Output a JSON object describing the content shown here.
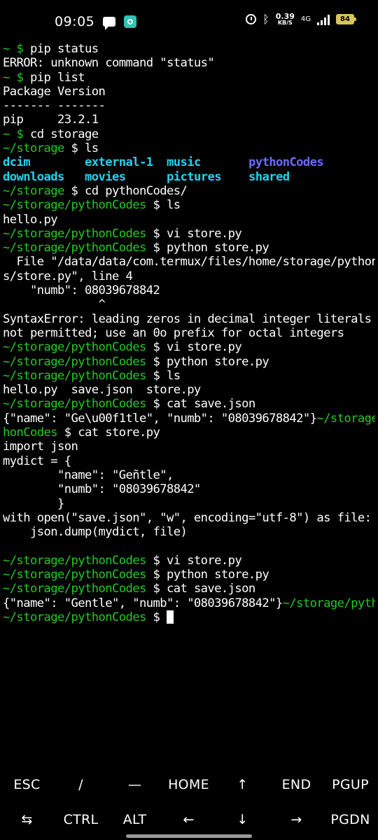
{
  "status_bar": {
    "time": "09:05",
    "net_speed": "0.39",
    "net_speed_unit": "KB/S",
    "network_type": "4G",
    "battery": "84",
    "icons": [
      "message-icon",
      "app-notification-icon",
      "alarm-icon",
      "bluetooth-icon",
      "signal-icon",
      "battery-icon"
    ]
  },
  "terminal": {
    "lines": [
      [
        {
          "t": "~ $ ",
          "c": "green"
        },
        {
          "t": "pip status",
          "c": "white"
        }
      ],
      [
        {
          "t": "ERROR: unknown command \"status\"",
          "c": "white"
        }
      ],
      [
        {
          "t": "~ $ ",
          "c": "green"
        },
        {
          "t": "pip list",
          "c": "white"
        }
      ],
      [
        {
          "t": "Package Version",
          "c": "white"
        }
      ],
      [
        {
          "t": "------- -------",
          "c": "white"
        }
      ],
      [
        {
          "t": "pip     23.2.1",
          "c": "white"
        }
      ],
      [
        {
          "t": "~ $ ",
          "c": "green"
        },
        {
          "t": "cd storage",
          "c": "white"
        }
      ],
      [
        {
          "t": "~/storage ",
          "c": "green"
        },
        {
          "t": "$ ls",
          "c": "white"
        }
      ],
      [
        {
          "t": "dcim        ",
          "c": "cyan"
        },
        {
          "t": "external-1  ",
          "c": "cyan"
        },
        {
          "t": "music       ",
          "c": "cyan"
        },
        {
          "t": "pythonCodes",
          "c": "blue"
        }
      ],
      [
        {
          "t": "downloads   ",
          "c": "cyan"
        },
        {
          "t": "movies      ",
          "c": "cyan"
        },
        {
          "t": "pictures    ",
          "c": "cyan"
        },
        {
          "t": "shared",
          "c": "cyan"
        }
      ],
      [
        {
          "t": "~/storage ",
          "c": "green"
        },
        {
          "t": "$ cd pythonCodes/",
          "c": "white"
        }
      ],
      [
        {
          "t": "~/storage/pythonCodes ",
          "c": "green"
        },
        {
          "t": "$ ls",
          "c": "white"
        }
      ],
      [
        {
          "t": "hello.py",
          "c": "white"
        }
      ],
      [
        {
          "t": "~/storage/pythonCodes ",
          "c": "green"
        },
        {
          "t": "$ vi store.py",
          "c": "white"
        }
      ],
      [
        {
          "t": "~/storage/pythonCodes ",
          "c": "green"
        },
        {
          "t": "$ python store.py",
          "c": "white"
        }
      ],
      [
        {
          "t": "  File \"/data/data/com.termux/files/home/storage/pythonCode",
          "c": "white"
        }
      ],
      [
        {
          "t": "s/store.py\", line 4",
          "c": "white"
        }
      ],
      [
        {
          "t": "    \"numb\": 08039678842",
          "c": "white"
        }
      ],
      [
        {
          "t": "              ^",
          "c": "white"
        }
      ],
      [
        {
          "t": "SyntaxError: leading zeros in decimal integer literals are",
          "c": "white"
        }
      ],
      [
        {
          "t": "not permitted; use an 0o prefix for octal integers",
          "c": "white"
        }
      ],
      [
        {
          "t": "~/storage/pythonCodes ",
          "c": "green"
        },
        {
          "t": "$ vi store.py",
          "c": "white"
        }
      ],
      [
        {
          "t": "~/storage/pythonCodes ",
          "c": "green"
        },
        {
          "t": "$ python store.py",
          "c": "white"
        }
      ],
      [
        {
          "t": "~/storage/pythonCodes ",
          "c": "green"
        },
        {
          "t": "$ ls",
          "c": "white"
        }
      ],
      [
        {
          "t": "hello.py  save.json  store.py",
          "c": "white"
        }
      ],
      [
        {
          "t": "~/storage/pythonCodes ",
          "c": "green"
        },
        {
          "t": "$ cat save.json",
          "c": "white"
        }
      ],
      [
        {
          "t": "{\"name\": \"Ge\\u00f1tle\", \"numb\": \"08039678842\"}",
          "c": "white"
        },
        {
          "t": "~/storage/pyt",
          "c": "green"
        }
      ],
      [
        {
          "t": "honCodes ",
          "c": "green"
        },
        {
          "t": "$ cat store.py",
          "c": "white"
        }
      ],
      [
        {
          "t": "import json",
          "c": "white"
        }
      ],
      [
        {
          "t": "mydict = {",
          "c": "white"
        }
      ],
      [
        {
          "t": "        \"name\": \"Geñtle\",",
          "c": "white"
        }
      ],
      [
        {
          "t": "        \"numb\": \"08039678842\"",
          "c": "white"
        }
      ],
      [
        {
          "t": "        }",
          "c": "white"
        }
      ],
      [
        {
          "t": "with open(\"save.json\", \"w\", encoding=\"utf-8\") as file:",
          "c": "white"
        }
      ],
      [
        {
          "t": "    json.dump(mydict, file)",
          "c": "white"
        }
      ],
      [
        {
          "t": "",
          "c": "white"
        }
      ],
      [
        {
          "t": "~/storage/pythonCodes ",
          "c": "green"
        },
        {
          "t": "$ vi store.py",
          "c": "white"
        }
      ],
      [
        {
          "t": "~/storage/pythonCodes ",
          "c": "green"
        },
        {
          "t": "$ python store.py",
          "c": "white"
        }
      ],
      [
        {
          "t": "~/storage/pythonCodes ",
          "c": "green"
        },
        {
          "t": "$ cat save.json",
          "c": "white"
        }
      ],
      [
        {
          "t": "{\"name\": \"Gentle\", \"numb\": \"08039678842\"}",
          "c": "white"
        },
        {
          "t": "~/storage/pythonCo",
          "c": "green"
        }
      ],
      [
        {
          "t": "~/storage/pythonCodes ",
          "c": "green"
        },
        {
          "t": "$ ",
          "c": "white"
        }
      ]
    ]
  },
  "extra_keys": {
    "row1": [
      "ESC",
      "/",
      "—",
      "HOME",
      "↑",
      "END",
      "PGUP"
    ],
    "row2": [
      "⇆",
      "CTRL",
      "ALT",
      "←",
      "↓",
      "→",
      "PGDN"
    ]
  }
}
